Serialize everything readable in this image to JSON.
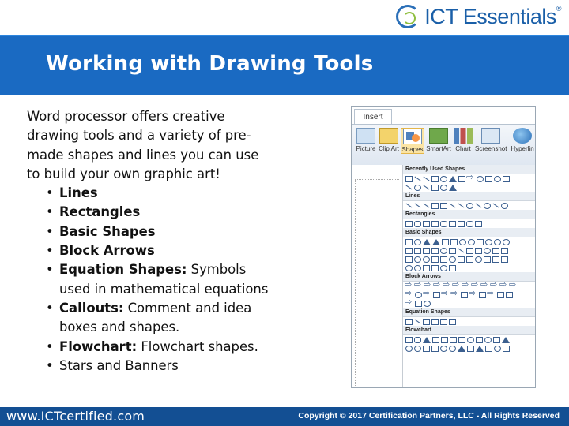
{
  "logo": {
    "text": "ICT Essentials",
    "reg": "®"
  },
  "slide": {
    "title": "Working with Drawing Tools",
    "intro": "Word processor offers creative drawing tools and a variety of pre-made shapes and lines you can use to build your own graphic art!",
    "bullets": [
      {
        "bold": "Lines",
        "rest": ""
      },
      {
        "bold": "Rectangles",
        "rest": ""
      },
      {
        "bold": "Basic Shapes",
        "rest": ""
      },
      {
        "bold": "Block Arrows",
        "rest": ""
      },
      {
        "bold": "Equation Shapes:",
        "rest": " Symbols used in mathematical equations"
      },
      {
        "bold": "Callouts:",
        "rest": " Comment and idea boxes and shapes."
      },
      {
        "bold": "Flowchart:",
        "rest": " Flowchart shapes."
      },
      {
        "bold": "",
        "rest": "Stars and Banners"
      }
    ]
  },
  "panel": {
    "tab": "Insert",
    "ribbon": [
      "Picture",
      "Clip Art",
      "Shapes",
      "SmartArt",
      "Chart",
      "Screenshot",
      "Hyperlin"
    ],
    "sections": [
      "Recently Used Shapes",
      "Lines",
      "Rectangles",
      "Basic Shapes",
      "Block Arrows",
      "Equation Shapes",
      "Flowchart"
    ]
  },
  "footer": {
    "url": "www.ICTcertified.com",
    "copyright": "Copyright © 2017 Certification Partners, LLC - All Rights Reserved"
  }
}
